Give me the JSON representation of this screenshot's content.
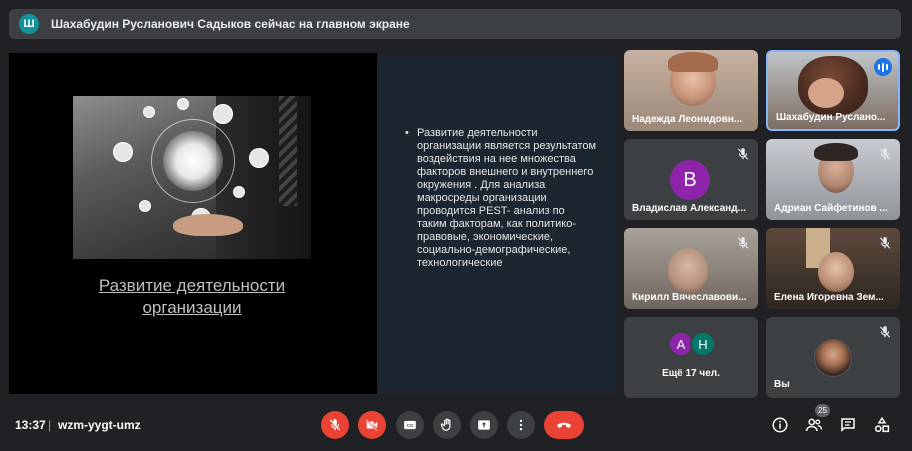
{
  "banner": {
    "avatar_letter": "Ш",
    "text": "Шахабудин Русланович Садыков сейчас на главном экране"
  },
  "slide": {
    "title": "Развитие деятельности организации",
    "bullet": "•",
    "body": "Развитие деятельности организации является результатом воздействия на нее множества факторов внешнего и внутреннего окружения . Для анализа макросреды организации проводится PEST- анализ по таким факторам, как политико-правовые, экономические, социально-демографические, технологические"
  },
  "participants": [
    {
      "name": "Надежда Леонидовн..."
    },
    {
      "name": "Шахабудин Руслано..."
    },
    {
      "name": "Владислав Александ...",
      "avatar_letter": "В",
      "avatar_color": "#8e24aa"
    },
    {
      "name": "Адриан Сайфетинов ..."
    },
    {
      "name": "Кирилл Вячеславови..."
    },
    {
      "name": "Елена Игоревна Зем..."
    }
  ],
  "more_tile": {
    "avatars": [
      {
        "letter": "А",
        "color": "#8e24aa"
      },
      {
        "letter": "Н",
        "color": "#00796b"
      }
    ],
    "label": "Ещё 17 чел."
  },
  "self_tile": {
    "label": "Вы"
  },
  "bottom": {
    "time": "13:37",
    "separator": "|",
    "meeting_code": "wzm-yygt-umz",
    "participants_count": "25"
  },
  "colors": {
    "background": "#202124",
    "tile": "#3c4043",
    "danger": "#ea4335",
    "speaking": "#1a73e8"
  },
  "icons": [
    "mic-off-icon",
    "cam-off-icon",
    "captions-icon",
    "raise-hand-icon",
    "present-icon",
    "more-vert-icon",
    "hangup-icon",
    "info-icon",
    "people-icon",
    "chat-icon",
    "activities-icon"
  ]
}
